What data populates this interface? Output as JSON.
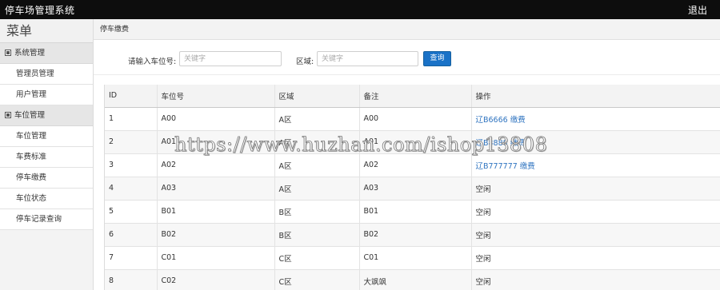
{
  "app": {
    "title": "停车场管理系统",
    "logout_label": "退出"
  },
  "sidebar": {
    "menu_title": "菜单",
    "groups": [
      {
        "label": "系统管理",
        "items": [
          {
            "label": "管理员管理"
          },
          {
            "label": "用户管理"
          }
        ]
      },
      {
        "label": "车位管理",
        "items": [
          {
            "label": "车位管理"
          },
          {
            "label": "车费标准"
          },
          {
            "label": "停车缴费"
          },
          {
            "label": "车位状态"
          },
          {
            "label": "停车记录查询"
          }
        ]
      }
    ]
  },
  "breadcrumb": "停车缴费",
  "search": {
    "space_label": "请输入车位号:",
    "space_placeholder": "关键字",
    "area_label": "区域:",
    "area_placeholder": "关键字",
    "query_label": "查询"
  },
  "table": {
    "headers": [
      "ID",
      "车位号",
      "区域",
      "备注",
      "操作"
    ],
    "rows": [
      {
        "id": "1",
        "space": "A00",
        "area": "A区",
        "note": "A00",
        "op": "辽B6666 缴费"
      },
      {
        "id": "2",
        "space": "A01",
        "area": "A区",
        "note": "A01",
        "op": "辽B8888 缴费"
      },
      {
        "id": "3",
        "space": "A02",
        "area": "A区",
        "note": "A02",
        "op": "辽B777777 缴费"
      },
      {
        "id": "4",
        "space": "A03",
        "area": "A区",
        "note": "A03",
        "op": "空闲"
      },
      {
        "id": "5",
        "space": "B01",
        "area": "B区",
        "note": "B01",
        "op": "空闲"
      },
      {
        "id": "6",
        "space": "B02",
        "area": "B区",
        "note": "B02",
        "op": "空闲"
      },
      {
        "id": "7",
        "space": "C01",
        "area": "C区",
        "note": "C01",
        "op": "空闲"
      },
      {
        "id": "8",
        "space": "C02",
        "area": "C区",
        "note": "大飒飒",
        "op": "空闲"
      }
    ]
  },
  "watermark": "https://www.huzhan.com/ishop13808",
  "colors": {
    "topbar": "#0d0d0d",
    "accent": "#1a72c7",
    "link": "#2f74c0"
  }
}
